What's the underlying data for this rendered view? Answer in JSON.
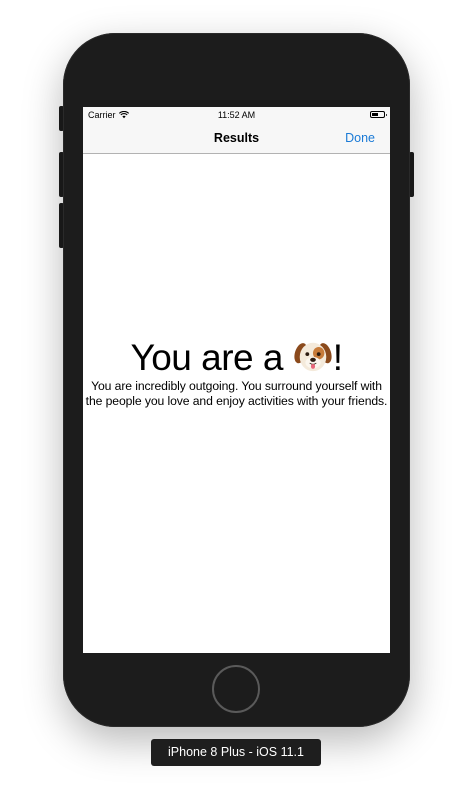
{
  "status_bar": {
    "carrier": "Carrier",
    "time": "11:52 AM",
    "wifi_icon": "wifi-icon",
    "battery_icon": "battery-icon"
  },
  "nav_bar": {
    "title": "Results",
    "done_label": "Done",
    "accent_color": "#1a7ad6"
  },
  "result": {
    "headline_prefix": "You are a ",
    "headline_emoji": "dog-face-icon",
    "headline_suffix": "!",
    "description": "You are incredibly outgoing. You surround yourself with the people you love and enjoy activities with your friends."
  },
  "simulator": {
    "device_label": "iPhone 8 Plus - iOS 11.1"
  }
}
